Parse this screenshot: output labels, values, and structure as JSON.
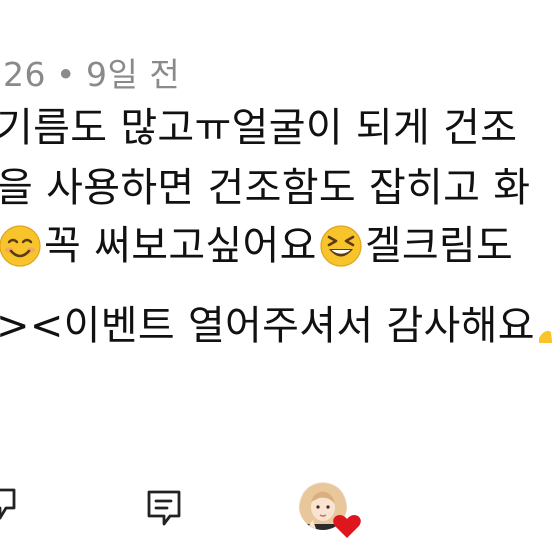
{
  "comment": {
    "meta": {
      "date": "26",
      "separator": "•",
      "likes_label": "9일 전"
    },
    "lines": [
      "기름도 많고ㅠ얼굴이 되게 건조",
      "을 사용하면 건조함도 잡히고 화",
      {
        "a": "꼭 써보고싶어요",
        "b": "겔크림도"
      },
      "><이벤트 열어주셔서 감사해요"
    ],
    "emoji": {
      "smile": "smiling-face-emoji",
      "grin": "grinning-squinting-face-emoji",
      "thumbs": "partial-emoji"
    }
  },
  "actions": {
    "like_icon": "like-icon",
    "reply_icon": "reply-icon",
    "profile_avatar": "avatar",
    "heart_badge": "heart-icon"
  },
  "colors": {
    "meta_text": "#8a8a8a",
    "text": "#111111",
    "emoji_yellow": "#f7c42b",
    "emoji_dark": "#5c3a16",
    "heart": "#e0161f"
  }
}
